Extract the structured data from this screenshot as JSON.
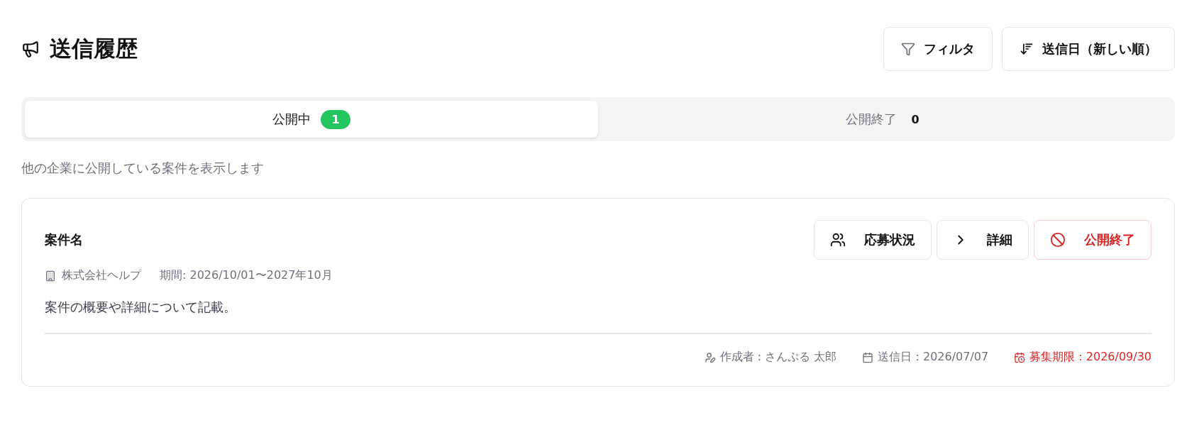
{
  "page": {
    "title": "送信履歴"
  },
  "toolbar": [
    {
      "kind": "filter",
      "label": "フィルタ"
    },
    {
      "kind": "sort",
      "label": "送信日（新しい順）"
    }
  ],
  "tabs": [
    {
      "label": "公開中",
      "count": "1",
      "selected": true
    },
    {
      "label": "公開終了",
      "count": "0",
      "selected": false
    }
  ],
  "description": "他の企業に公開している案件を表示します",
  "cards": [
    {
      "title": "案件名",
      "actions": [
        {
          "kind": "applicants",
          "label": "応募状況"
        },
        {
          "kind": "detail",
          "label": "詳細"
        },
        {
          "kind": "close",
          "label": "公開終了"
        }
      ],
      "company": "株式会社ヘルプ",
      "period": "期間: 2026/10/01〜2027年10月",
      "summary": "案件の概要や詳細について記載。",
      "footer": [
        {
          "kind": "author",
          "text": "作成者 : さんぷる 太郎",
          "color": "#6b7280"
        },
        {
          "kind": "sent",
          "text": "送信日 : 2026/07/07",
          "color": "#6b7280"
        },
        {
          "kind": "deadline",
          "text": "募集期限 : 2026/09/30",
          "color": "#dc2626"
        }
      ]
    }
  ]
}
